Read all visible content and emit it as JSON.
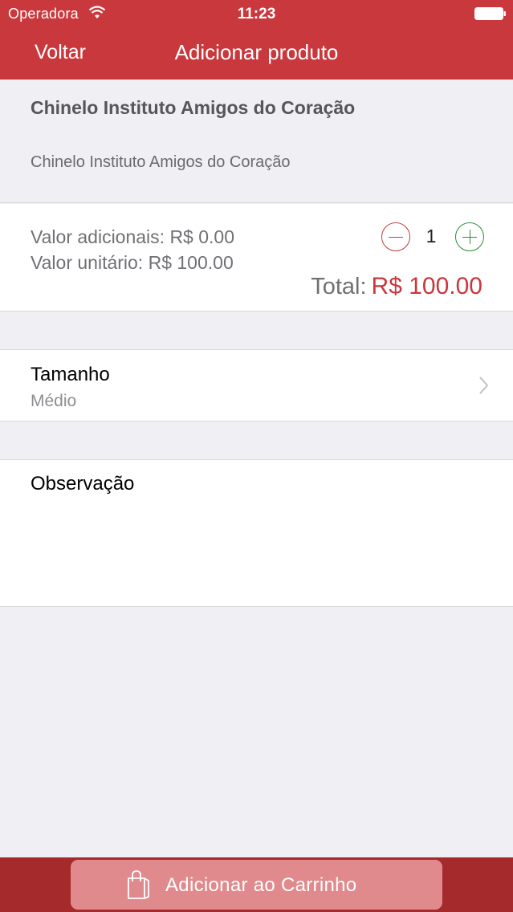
{
  "status_bar": {
    "carrier": "Operadora",
    "time": "11:23"
  },
  "nav": {
    "back_label": "Voltar",
    "title": "Adicionar produto"
  },
  "product": {
    "name": "Chinelo Instituto Amigos do Coração",
    "description": "Chinelo Instituto Amigos do Coração"
  },
  "pricing": {
    "additional_value": "Valor adicionais: R$ 0.00",
    "unit_value": "Valor unitário: R$ 100.00",
    "quantity": "1",
    "total_label": "Total:",
    "total_amount": "R$ 100.00"
  },
  "size": {
    "label": "Tamanho",
    "value": "Médio"
  },
  "observation": {
    "label": "Observação",
    "value": ""
  },
  "cart_button": {
    "label": "Adicionar ao Carrinho"
  },
  "colors": {
    "brand_red": "#c9383c",
    "minus_red": "#c63a3f",
    "plus_green": "#2b8c3a",
    "button_pink": "#e08a8d",
    "bottom_bar": "#a52a2c"
  },
  "icons": [
    "wifi-icon",
    "battery-icon",
    "minus-icon",
    "plus-icon",
    "chevron-right-icon",
    "shopping-bag-icon"
  ]
}
